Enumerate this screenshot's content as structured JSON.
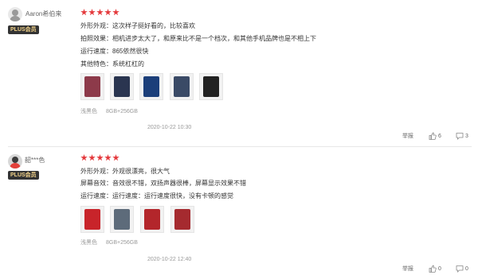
{
  "reviews": [
    {
      "username": "Aaron希伯来",
      "badge": "PLUS会员",
      "rating": 5,
      "lines": [
        "外形外观：这次样子挺好看的，比较喜欢",
        "拍照效果：相机进步太大了，和原来比不是一个档次，和其他手机品牌也是不相上下",
        "运行速度：865依然很快",
        "其他特色：系统杠杠的"
      ],
      "thumb_colors": [
        "#8d3a4a",
        "#2a3550",
        "#1c3f7a",
        "#3a4a66",
        "#222222"
      ],
      "spec_color": "浅黑色",
      "spec_memory": "8GB+256GB",
      "date": "2020-10-22 10:30",
      "report": "举报",
      "likes": "6",
      "comments": "3"
    },
    {
      "username": "韶***色",
      "badge": "PLUS会员",
      "rating": 5,
      "lines": [
        "外形外观：外观很漂亮，很大气",
        "屏幕音效：音效很不错，双扬声器很棒，屏幕显示效果不错",
        "运行速度：运行速度：运行速度很快，没有卡顿的感觉"
      ],
      "thumb_colors": [
        "#c8242a",
        "#5d6b7a",
        "#b3262b",
        "#a52a2f"
      ],
      "spec_color": "浅黑色",
      "spec_memory": "8GB+256GB",
      "date": "2020-10-22 12:40",
      "report": "举报",
      "likes": "0",
      "comments": "0"
    }
  ]
}
